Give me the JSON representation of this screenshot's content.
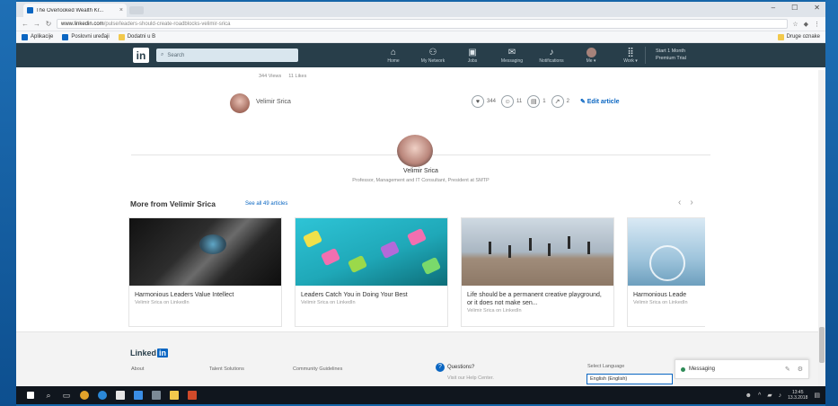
{
  "browser": {
    "tab_title": "The Overlooked Wealth Kr...",
    "tab_close": "×",
    "window_controls": [
      "–",
      "☐",
      "✕"
    ],
    "url_domain": "www.linkedin.com",
    "url_path": "/pulse/leaders-should-create-roadblocks-velimir-srica",
    "bookmarks": [
      "Aplikacije",
      "Poslovni uređaji",
      "Dodatni u B"
    ],
    "other_bookmarks": "Druge oznake"
  },
  "nav": {
    "logo": "in",
    "search_placeholder": "Search",
    "items": [
      {
        "icon": "⌂",
        "label": "Home",
        "name": "home"
      },
      {
        "icon": "⚇",
        "label": "My Network",
        "name": "my-network"
      },
      {
        "icon": "▣",
        "label": "Jobs",
        "name": "jobs"
      },
      {
        "icon": "✉",
        "label": "Messaging",
        "name": "messaging"
      },
      {
        "icon": "♪",
        "label": "Notifications",
        "name": "notifications"
      },
      {
        "icon": "",
        "label": "Me ▾",
        "name": "me"
      },
      {
        "icon": "⣿",
        "label": "Work ▾",
        "name": "work"
      }
    ],
    "premium_line1": "Start 1 Month",
    "premium_line2": "Premium Trial"
  },
  "article": {
    "stats": [
      "344 Views",
      "11 Likes"
    ],
    "author": "Velimir Srica",
    "actions": [
      {
        "icon": "♥",
        "count": "344",
        "name": "likes"
      },
      {
        "icon": "☺",
        "count": "11",
        "name": "reactions"
      },
      {
        "icon": "▤",
        "count": "1",
        "name": "comments"
      },
      {
        "icon": "↗",
        "count": "2",
        "name": "shares"
      }
    ],
    "edit_label": "✎ Edit article"
  },
  "profile": {
    "name": "Velimir Srica",
    "headline": "Professor, Management and IT Consultant, President at SMTP"
  },
  "more": {
    "title": "More from Velimir Srica",
    "see_all": "See all 49 articles",
    "pager": [
      "‹",
      "›"
    ],
    "cards": [
      {
        "title": "Harmonious Leaders Value Intellect",
        "sub": "Velimir Srica on LinkedIn",
        "name": "card-harmonious-leaders"
      },
      {
        "title": "Leaders Catch You in Doing Your Best",
        "sub": "Velimir Srica on LinkedIn",
        "name": "card-leaders-catch"
      },
      {
        "title": "Life should be a permanent creative playground, or it does not make sen...",
        "sub": "Velimir Srica on LinkedIn",
        "name": "card-life-playground"
      },
      {
        "title": "Harmonious Leade",
        "sub": "Velimir Srica on LinkedIn",
        "name": "card-harmonious-leade"
      }
    ]
  },
  "footer": {
    "logo": "Linked",
    "logo_in": "in",
    "cols": [
      "About",
      "Talent Solutions",
      "Community Guidelines"
    ],
    "question": "Questions?",
    "question_sub": "Visit our Help Center.",
    "select_language": "Select Language",
    "language": "English (English)"
  },
  "messaging": {
    "label": "Messaging"
  },
  "taskbar": {
    "clock_time": "13:45",
    "clock_date": "13.3.2018"
  }
}
